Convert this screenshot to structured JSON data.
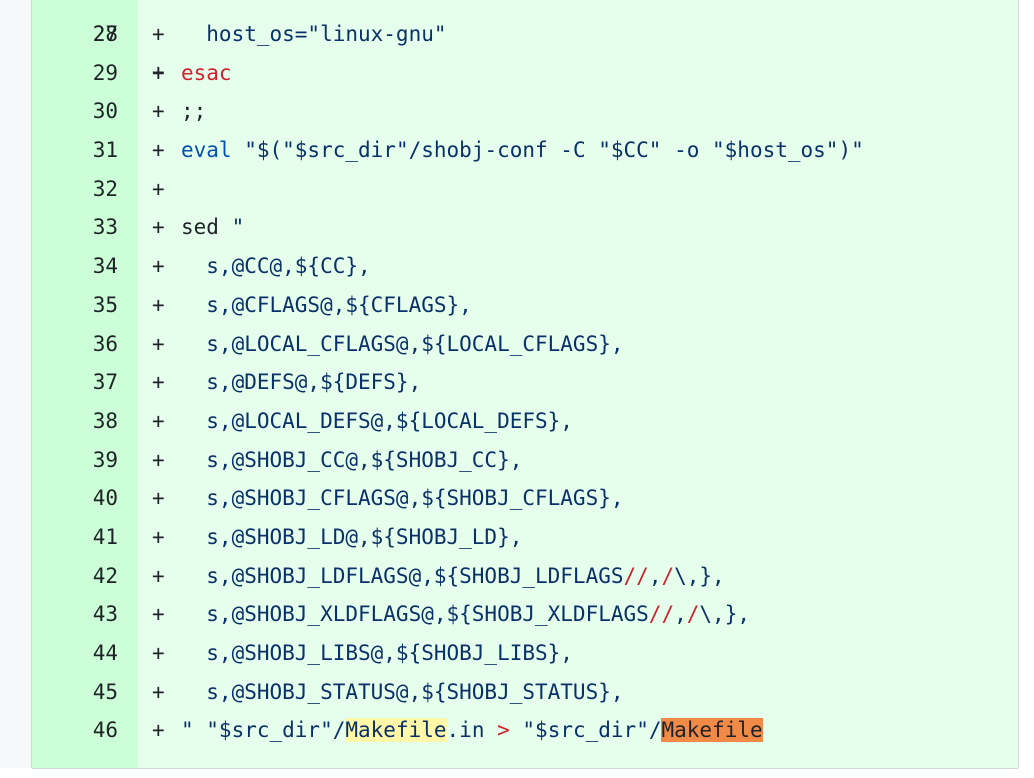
{
  "diff": {
    "partial_top": {
      "number": "27",
      "marker": "+",
      "code": ";;"
    },
    "lines": [
      {
        "number": "28",
        "marker": "+",
        "segments": [
          {
            "t": "  host_os=\"linux-gnu\"",
            "c": "str"
          }
        ]
      },
      {
        "number": "29",
        "marker": "+",
        "segments": [
          {
            "t": "esac",
            "c": "kw"
          }
        ]
      },
      {
        "number": "30",
        "marker": "+",
        "segments": []
      },
      {
        "number": "31",
        "marker": "+",
        "segments": [
          {
            "t": "eval",
            "c": "fn"
          },
          {
            "t": " \"$(\"$src_dir\"/shobj-conf -C \"$CC\" -o \"$host_os\")\"",
            "c": "str"
          }
        ]
      },
      {
        "number": "32",
        "marker": "+",
        "segments": []
      },
      {
        "number": "33",
        "marker": "+",
        "segments": [
          {
            "t": "sed ",
            "c": ""
          },
          {
            "t": "\"",
            "c": "str"
          }
        ]
      },
      {
        "number": "34",
        "marker": "+",
        "segments": [
          {
            "t": "  s,@CC@,${CC},",
            "c": "str"
          }
        ]
      },
      {
        "number": "35",
        "marker": "+",
        "segments": [
          {
            "t": "  s,@CFLAGS@,${CFLAGS},",
            "c": "str"
          }
        ]
      },
      {
        "number": "36",
        "marker": "+",
        "segments": [
          {
            "t": "  s,@LOCAL_CFLAGS@,${LOCAL_CFLAGS},",
            "c": "str"
          }
        ]
      },
      {
        "number": "37",
        "marker": "+",
        "segments": [
          {
            "t": "  s,@DEFS@,${DEFS},",
            "c": "str"
          }
        ]
      },
      {
        "number": "38",
        "marker": "+",
        "segments": [
          {
            "t": "  s,@LOCAL_DEFS@,${LOCAL_DEFS},",
            "c": "str"
          }
        ]
      },
      {
        "number": "39",
        "marker": "+",
        "segments": [
          {
            "t": "  s,@SHOBJ_CC@,${SHOBJ_CC},",
            "c": "str"
          }
        ]
      },
      {
        "number": "40",
        "marker": "+",
        "segments": [
          {
            "t": "  s,@SHOBJ_CFLAGS@,${SHOBJ_CFLAGS},",
            "c": "str"
          }
        ]
      },
      {
        "number": "41",
        "marker": "+",
        "segments": [
          {
            "t": "  s,@SHOBJ_LD@,${SHOBJ_LD},",
            "c": "str"
          }
        ]
      },
      {
        "number": "42",
        "marker": "+",
        "segments": [
          {
            "t": "  s,@SHOBJ_LDFLAGS@,${SHOBJ_LDFLAGS",
            "c": "str"
          },
          {
            "t": "//",
            "c": "op"
          },
          {
            "t": ",",
            "c": "str"
          },
          {
            "t": "/",
            "c": "op"
          },
          {
            "t": "\\,},",
            "c": "str"
          }
        ]
      },
      {
        "number": "43",
        "marker": "+",
        "segments": [
          {
            "t": "  s,@SHOBJ_XLDFLAGS@,${SHOBJ_XLDFLAGS",
            "c": "str"
          },
          {
            "t": "//",
            "c": "op"
          },
          {
            "t": ",",
            "c": "str"
          },
          {
            "t": "/",
            "c": "op"
          },
          {
            "t": "\\,},",
            "c": "str"
          }
        ]
      },
      {
        "number": "44",
        "marker": "+",
        "segments": [
          {
            "t": "  s,@SHOBJ_LIBS@,${SHOBJ_LIBS},",
            "c": "str"
          }
        ]
      },
      {
        "number": "45",
        "marker": "+",
        "segments": [
          {
            "t": "  s,@SHOBJ_STATUS@,${SHOBJ_STATUS},",
            "c": "str"
          }
        ]
      },
      {
        "number": "46",
        "marker": "+",
        "segments": [
          {
            "t": "\" \"$src_dir\"/",
            "c": "str"
          },
          {
            "t": "Makefile",
            "c": "hl-yellow"
          },
          {
            "t": ".in ",
            "c": "str"
          },
          {
            "t": ">",
            "c": "op"
          },
          {
            "t": " \"$src_dir\"/",
            "c": "str"
          },
          {
            "t": "Makefile",
            "c": "hl-orange"
          }
        ]
      }
    ]
  }
}
